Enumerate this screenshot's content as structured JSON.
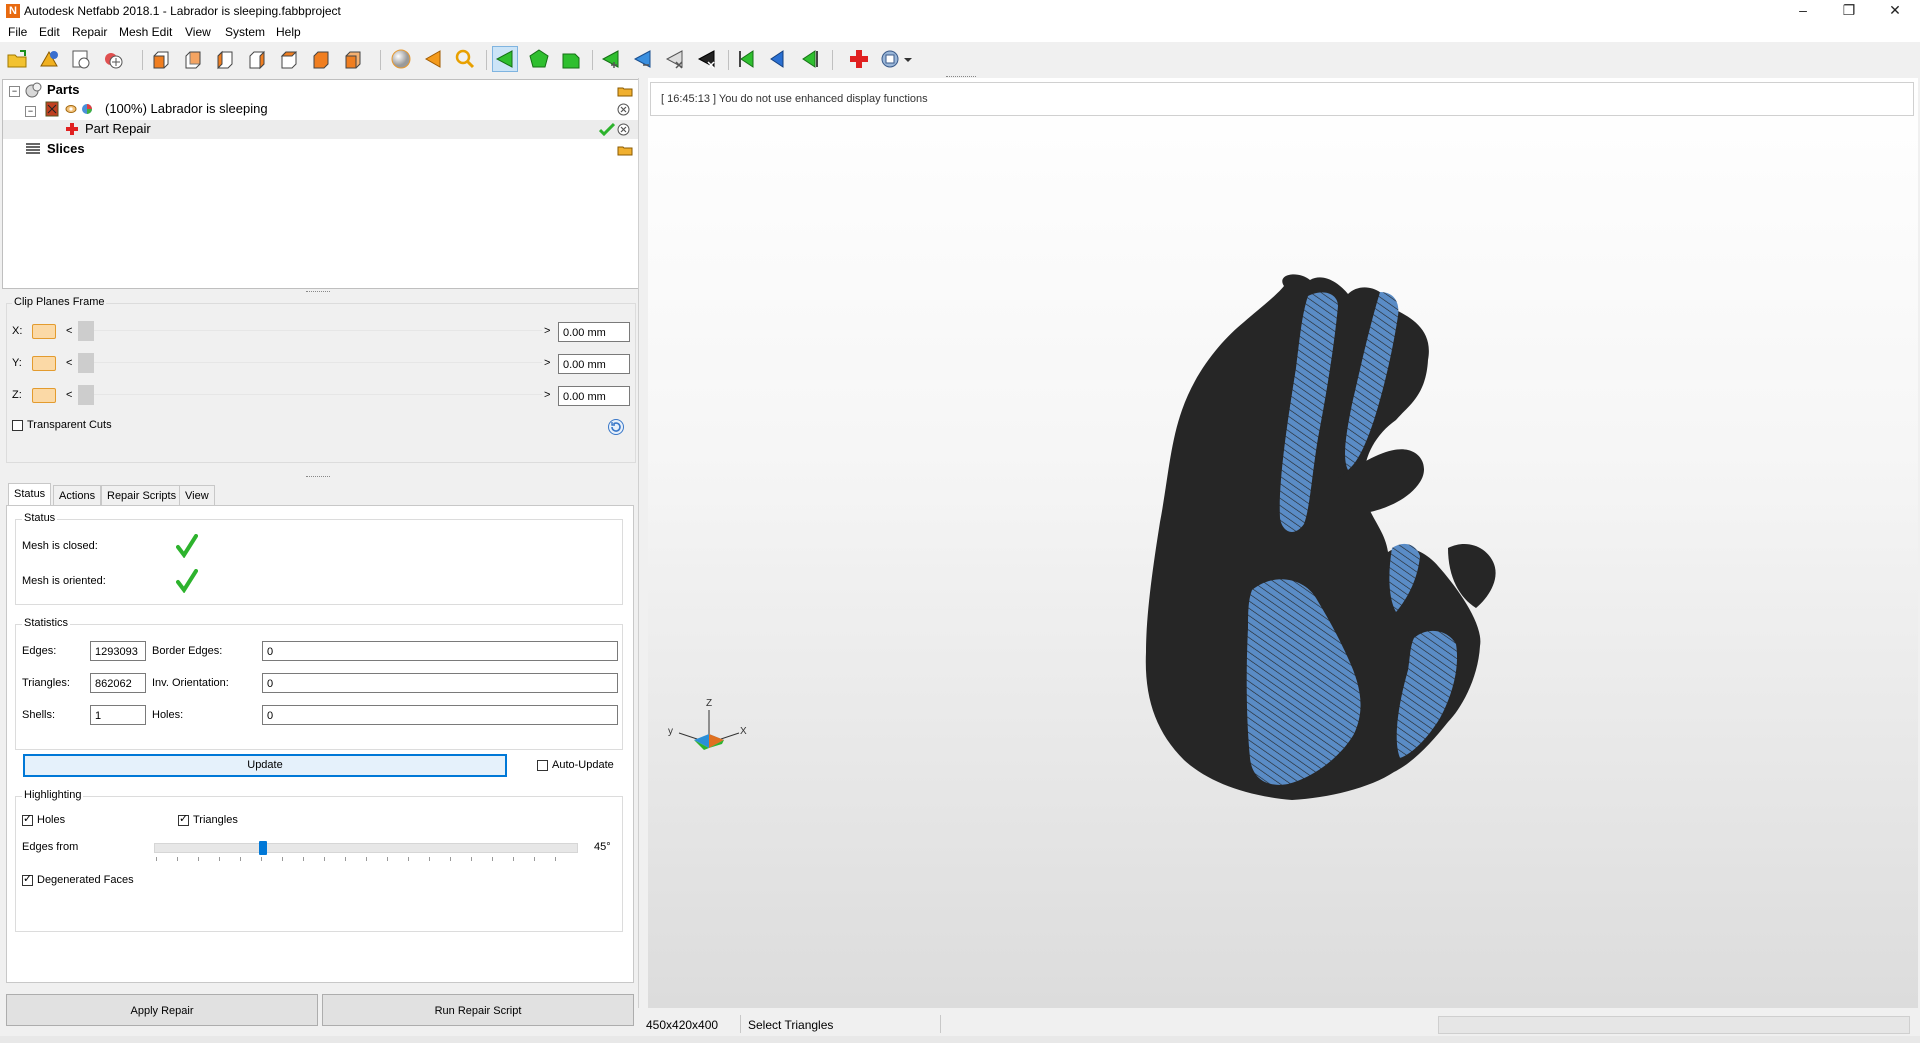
{
  "window": {
    "title": "Autodesk Netfabb 2018.1 - Labrador is sleeping.fabbproject",
    "app_icon_letter": "N"
  },
  "menu": [
    "File",
    "Edit",
    "Repair",
    "Mesh Edit",
    "View",
    "System",
    "Help"
  ],
  "tree": {
    "parts_label": "Parts",
    "part_label": "(100%) Labrador is sleeping",
    "repair_label": "Part Repair",
    "slices_label": "Slices"
  },
  "clip": {
    "frame_label": "Clip Planes Frame",
    "x_label": "X:",
    "y_label": "Y:",
    "z_label": "Z:",
    "x_value": "0.00 mm",
    "y_value": "0.00 mm",
    "z_value": "0.00 mm",
    "left_arrow": "<",
    "right_arrow": ">",
    "transparent_label": "Transparent Cuts",
    "transparent_checked": false
  },
  "tabs": [
    "Status",
    "Actions",
    "Repair Scripts",
    "View"
  ],
  "status": {
    "group_label": "Status",
    "closed_label": "Mesh is closed:",
    "oriented_label": "Mesh is oriented:"
  },
  "statistics": {
    "group_label": "Statistics",
    "edges_label": "Edges:",
    "edges_value": "1293093",
    "border_edges_label": "Border Edges:",
    "border_edges_value": "0",
    "triangles_label": "Triangles:",
    "triangles_value": "862062",
    "inv_orientation_label": "Inv. Orientation:",
    "inv_orientation_value": "0",
    "shells_label": "Shells:",
    "shells_value": "1",
    "holes_label": "Holes:",
    "holes_value": "0",
    "update_label": "Update",
    "auto_update_label": "Auto-Update"
  },
  "highlighting": {
    "group_label": "Highlighting",
    "holes_label": "Holes",
    "triangles_label": "Triangles",
    "edges_from_label": "Edges from",
    "edges_from_value": "45°",
    "edges_from_fraction": 0.25,
    "degenerated_label": "Degenerated Faces"
  },
  "buttons": {
    "apply_repair": "Apply Repair",
    "run_repair_script": "Run Repair Script"
  },
  "log_message": "[ 16:45:13 ] You do not use enhanced display functions",
  "axes": {
    "z": "Z",
    "x": "X",
    "y": "y"
  },
  "statusbar": {
    "size": "450x420x400",
    "mode": "Select Triangles"
  },
  "colors": {
    "accent": "#0078d7",
    "check_green": "#2db32d",
    "mesh_dark": "#262626",
    "mesh_blue": "#4a7fb8",
    "repair_red": "#e02020"
  }
}
